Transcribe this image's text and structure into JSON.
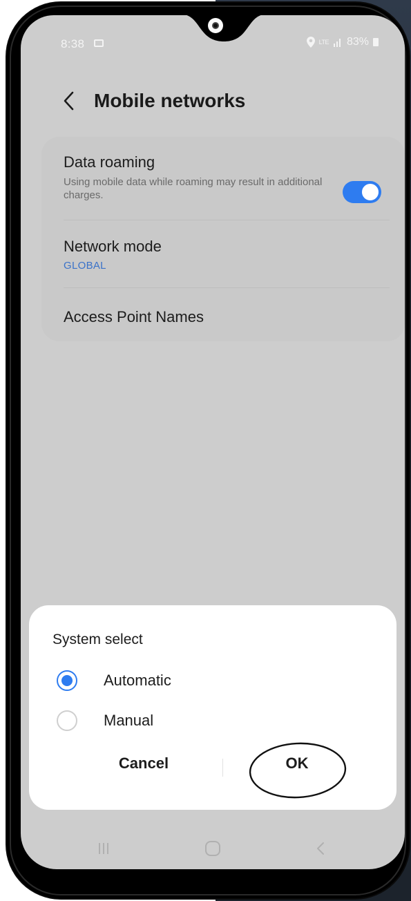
{
  "status_bar": {
    "time": "8:38",
    "network": "LTE",
    "battery": "83%"
  },
  "header": {
    "title": "Mobile networks"
  },
  "settings": {
    "data_roaming": {
      "title": "Data roaming",
      "description": "Using mobile data while roaming may result in additional charges.",
      "enabled": true
    },
    "network_mode": {
      "title": "Network mode",
      "value": "GLOBAL"
    },
    "access_point_names": {
      "title": "Access Point Names"
    }
  },
  "dialog": {
    "title": "System select",
    "options": [
      {
        "label": "Automatic",
        "selected": true
      },
      {
        "label": "Manual",
        "selected": false
      }
    ],
    "cancel_label": "Cancel",
    "ok_label": "OK"
  },
  "colors": {
    "accent": "#2e7cf0",
    "link": "#3a72c9",
    "screen_dimmed": "#cdcdcd",
    "dialog_bg": "#ffffff"
  },
  "icons": {
    "back": "chevron-left-icon",
    "recent_apps": "recent-apps-icon",
    "home": "home-icon",
    "nav_back": "nav-back-icon"
  }
}
